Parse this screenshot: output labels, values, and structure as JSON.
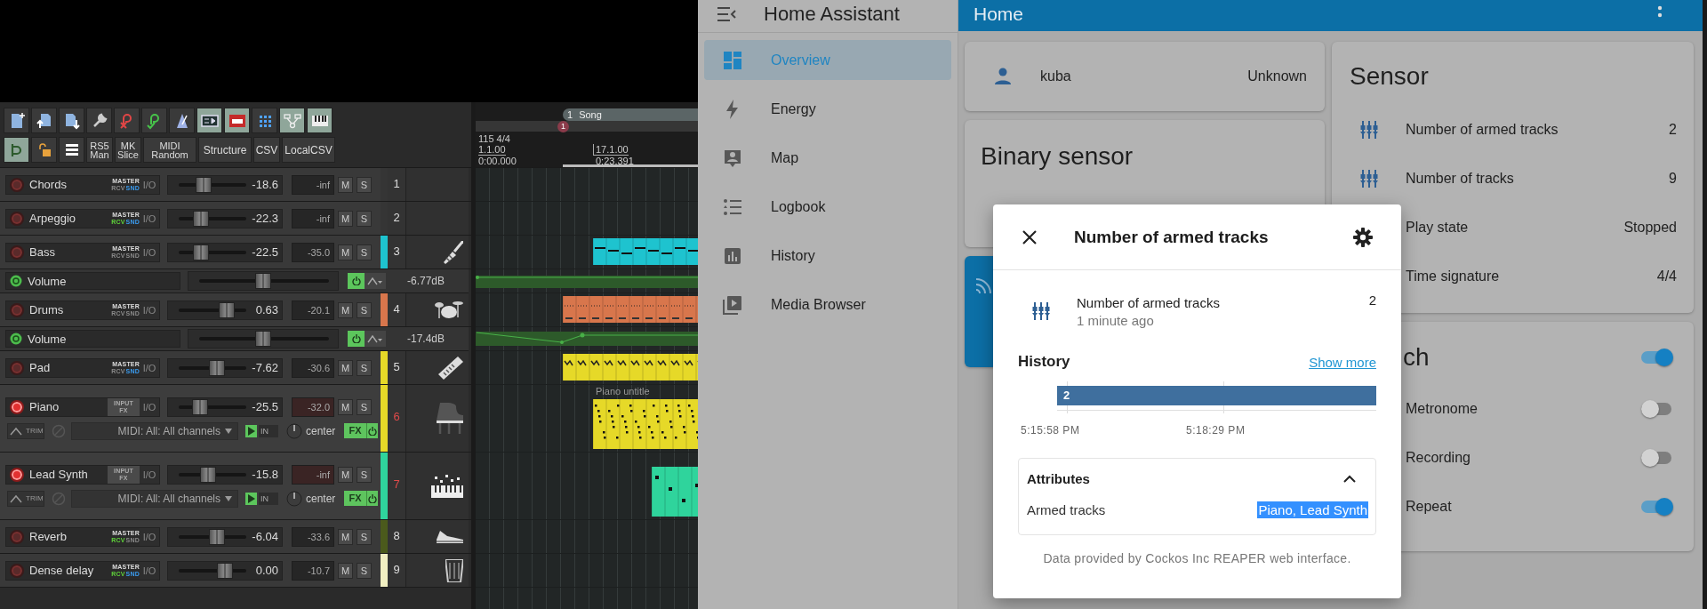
{
  "reaper": {
    "toolbar": {
      "icon_buttons": [
        {
          "active": false
        },
        {
          "active": false
        },
        {
          "active": false
        },
        {
          "active": false
        },
        {
          "active": false
        },
        {
          "active": false
        },
        {
          "active": false
        },
        {
          "active": true
        },
        {
          "active": true
        },
        {
          "active": false
        },
        {
          "active": true
        },
        {
          "active": true
        }
      ],
      "row2_icons": [
        {
          "active": true
        },
        {
          "active": false
        },
        {
          "active": false
        }
      ],
      "text_buttons": [
        "RS5 Man",
        "MK Slice",
        "MIDI Random",
        "Structure",
        "CSV",
        "LocalCSV"
      ]
    },
    "ruler": {
      "region_number": "1",
      "region": "Song",
      "marker": "1",
      "tempo": "115 4/4",
      "bar_start": "1.1.00",
      "time_start": "0:00.000",
      "bar_mid": "17.1.00",
      "time_mid": "0:23.391"
    },
    "tracks": [
      {
        "kind": "track",
        "number": "1",
        "name": "Chords",
        "armed": false,
        "badge": {
          "kind": "send",
          "top": "MASTER",
          "rcv": "RCV",
          "rcv_on": false,
          "snd": "SND",
          "snd_on": true
        },
        "io": "I/O",
        "level": 0.37,
        "volume": "-18.6",
        "peak": "-inf",
        "mute": "M",
        "solo": "S"
      },
      {
        "kind": "track",
        "number": "2",
        "name": "Arpeggio",
        "armed": false,
        "badge": {
          "kind": "send",
          "top": "MASTER",
          "rcv": "RCV",
          "rcv_on": true,
          "snd": "SND",
          "snd_on": true
        },
        "io": "I/O",
        "level": 0.33,
        "volume": "-22.3",
        "peak": "-inf",
        "mute": "M",
        "solo": "S"
      },
      {
        "kind": "track",
        "number": "3",
        "name": "Bass",
        "armed": false,
        "color": "#1ec3cf",
        "badge": {
          "kind": "send",
          "top": "MASTER",
          "rcv": "RCV",
          "rcv_on": false,
          "snd": "SND",
          "snd_on": false
        },
        "io": "I/O",
        "level": 0.33,
        "volume": "-22.5",
        "peak": "-35.0",
        "mute": "M",
        "solo": "S"
      },
      {
        "kind": "envelope",
        "name": "Volume",
        "on": true,
        "level": 0.49,
        "value": "-6.77dB"
      },
      {
        "kind": "track",
        "number": "4",
        "name": "Drums",
        "armed": false,
        "color": "#d8764c",
        "badge": {
          "kind": "send",
          "top": "MASTER",
          "rcv": "RCV",
          "rcv_on": false,
          "snd": "SND",
          "snd_on": false
        },
        "io": "I/O",
        "level": 0.71,
        "volume": "0.63",
        "peak": "-20.1",
        "mute": "M",
        "solo": "S"
      },
      {
        "kind": "envelope",
        "name": "Volume",
        "on": true,
        "level": 0.49,
        "value": "-17.4dB"
      },
      {
        "kind": "track",
        "number": "5",
        "name": "Pad",
        "armed": false,
        "color": "#e6d928",
        "badge": {
          "kind": "send",
          "top": "MASTER",
          "rcv": "RCV",
          "rcv_on": false,
          "snd": "SND",
          "snd_on": true
        },
        "io": "I/O",
        "level": 0.56,
        "volume": "-7.62",
        "peak": "-30.6",
        "mute": "M",
        "solo": "S"
      },
      {
        "kind": "track",
        "number": "6",
        "name": "Piano",
        "armed": true,
        "color": "#e6d928",
        "badge": {
          "kind": "fx",
          "top": "INPUT",
          "bottom": "FX"
        },
        "io": "I/O",
        "level": 0.31,
        "volume": "-25.5",
        "peak": "-32.0",
        "mute": "M",
        "solo": "S",
        "midi": {
          "trim": "TRIM",
          "input": "MIDI: All: All channels",
          "in": "IN",
          "pan": "center",
          "fx": "FX"
        },
        "item_label": "Piano untitle"
      },
      {
        "kind": "track",
        "number": "7",
        "name": "Lead Synth",
        "armed": true,
        "color": "#2fd49c",
        "badge": {
          "kind": "fx",
          "top": "INPUT",
          "bottom": "FX"
        },
        "io": "I/O",
        "level": 0.43,
        "volume": "-15.8",
        "peak": "-inf",
        "mute": "M",
        "solo": "S",
        "midi": {
          "trim": "TRIM",
          "input": "MIDI: All: All channels",
          "in": "IN",
          "pan": "center",
          "fx": "FX"
        }
      },
      {
        "kind": "track",
        "number": "8",
        "name": "Reverb",
        "armed": false,
        "color": "#4b5a1c",
        "badge": {
          "kind": "send",
          "top": "MASTER",
          "rcv": "RCV",
          "rcv_on": true,
          "snd": "SND",
          "snd_on": false
        },
        "io": "I/O",
        "level": 0.57,
        "volume": "-6.04",
        "peak": "-33.6",
        "mute": "M",
        "solo": "S"
      },
      {
        "kind": "track",
        "number": "9",
        "name": "Dense delay",
        "armed": false,
        "color": "#f1efc2",
        "badge": {
          "kind": "send",
          "top": "MASTER",
          "rcv": "RCV",
          "rcv_on": true,
          "snd": "SND",
          "snd_on": true
        },
        "io": "I/O",
        "level": 0.69,
        "volume": "0.00",
        "peak": "-10.7",
        "mute": "M",
        "solo": "S"
      }
    ]
  },
  "home_assistant": {
    "app_title": "Home Assistant",
    "sidebar": [
      {
        "label": "Overview",
        "selected": true
      },
      {
        "label": "Energy",
        "selected": false
      },
      {
        "label": "Map",
        "selected": false
      },
      {
        "label": "Logbook",
        "selected": false
      },
      {
        "label": "History",
        "selected": false
      },
      {
        "label": "Media Browser",
        "selected": false
      }
    ],
    "header": {
      "title": "Home"
    },
    "person_card": {
      "name": "kuba",
      "state": "Unknown"
    },
    "binary_sensor_card": {
      "title": "Binary sensor"
    },
    "sensor_card": {
      "title": "Sensor",
      "rows": [
        {
          "label": "Number of armed tracks",
          "value": "2",
          "icon": true
        },
        {
          "label": "Number of tracks",
          "value": "9",
          "icon": true
        },
        {
          "label": "Play state",
          "value": "Stopped",
          "icon": false
        },
        {
          "label": "Time signature",
          "value": "4/4",
          "icon": false
        }
      ]
    },
    "switch_card": {
      "title": "ch",
      "on": true,
      "rows": [
        {
          "label": "Metronome",
          "on": false
        },
        {
          "label": "Recording",
          "on": false
        },
        {
          "label": "Repeat",
          "on": true
        }
      ]
    },
    "dialog": {
      "title": "Number of armed tracks",
      "entity": {
        "name": "Number of armed tracks",
        "time": "1 minute ago",
        "value": "2"
      },
      "history": "History",
      "show_more": "Show more",
      "timeline": {
        "bar_label": "2",
        "ticks": [
          "5:15:58 PM",
          "5:18:29 PM"
        ]
      },
      "attributes": {
        "title": "Attributes",
        "expanded": true,
        "rows": [
          {
            "label": "Armed tracks",
            "value": "Piano, Lead Synth",
            "highlighted": true
          }
        ]
      },
      "footer": "Data provided by Cockos Inc REAPER web interface."
    }
  }
}
